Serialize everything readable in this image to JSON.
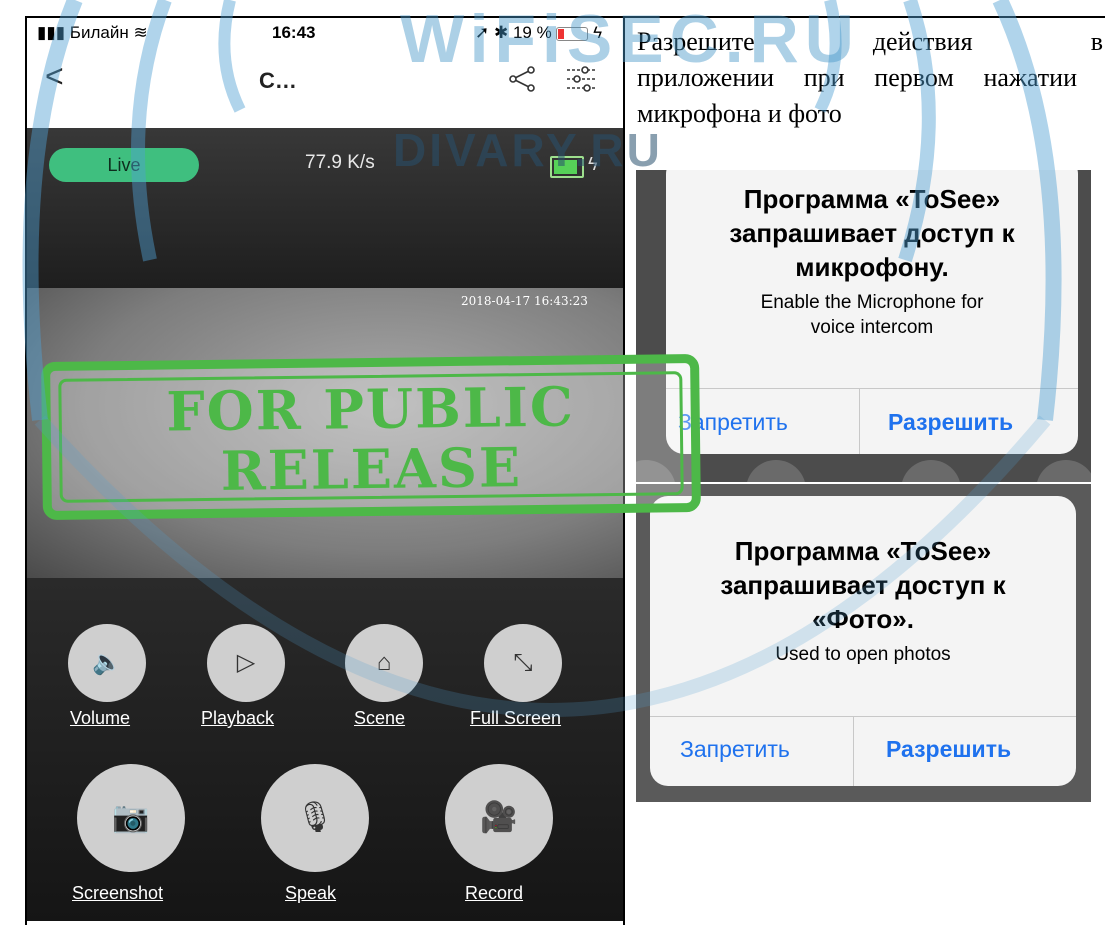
{
  "phone": {
    "status": {
      "carrier": "Билайн",
      "time": "16:43",
      "battery": "19 %"
    },
    "nav": {
      "back": "<",
      "title": "C…"
    },
    "live": "Live",
    "speed": "77.9 K/s",
    "timestamp": "2018-04-17 16:43:23",
    "controls": [
      {
        "label": "Volume",
        "icon": "volume-icon",
        "glyph": "🔈"
      },
      {
        "label": "Playback",
        "icon": "play-icon",
        "glyph": "▷"
      },
      {
        "label": "Scene",
        "icon": "home-icon",
        "glyph": "⌂"
      },
      {
        "label": "Full Screen",
        "icon": "expand-icon",
        "glyph": "⤡"
      }
    ],
    "actions": [
      {
        "label": "Screenshot",
        "icon": "camera-icon",
        "glyph": "📷"
      },
      {
        "label": "Speak",
        "icon": "microphone-icon",
        "glyph": "🎙"
      },
      {
        "label": "Record",
        "icon": "video-camera-icon",
        "glyph": "🎥"
      }
    ]
  },
  "description": {
    "line1_a": "Разрешите",
    "line1_b": "действия",
    "line1_c": "в",
    "rest": "приложении при первом нажатии микрофона и фото"
  },
  "dialog_mic": {
    "title": "Программа «ToSee» запрашивает доступ к микрофону.",
    "message": "Enable the Microphone for voice intercom",
    "deny": "Запретить",
    "allow": "Разрешить"
  },
  "dialog_photo": {
    "title": "Программа «ToSee» запрашивает доступ к «Фото».",
    "message": "Used to open photos",
    "deny": "Запретить",
    "allow": "Разрешить"
  },
  "stamp": {
    "line1": "FOR PUBLIC",
    "line2": "RELEASE"
  },
  "watermark": {
    "main": "WiFiSEC.RU",
    "secondary": "DIVARY.RU"
  },
  "colors": {
    "accent_green": "#4db848",
    "live_green": "#3fbf7f",
    "ios_blue": "#1f72ee"
  }
}
